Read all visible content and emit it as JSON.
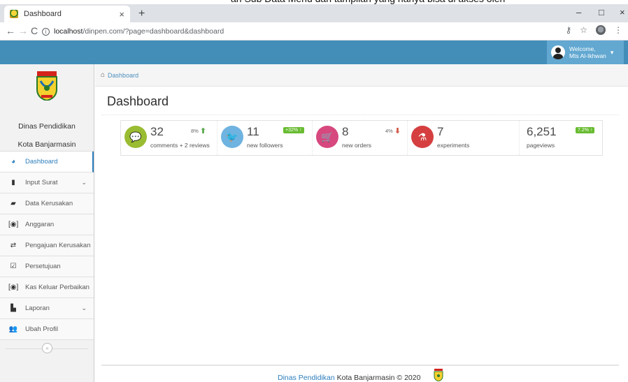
{
  "browser": {
    "tab_title": "Dashboard",
    "tab_close": "×",
    "new_tab": "+",
    "window_controls": [
      "–",
      "□",
      "×"
    ],
    "url_host": "localhost",
    "url_path": "/dinpen.com/?page=dashboard&dashboard",
    "icons": [
      "key-icon",
      "star-icon",
      "extension-icon",
      "menu-icon"
    ]
  },
  "header": {
    "welcome": "Welcome,",
    "username": "Mts Al-Ikhwan"
  },
  "sidebar": {
    "brand_line1": "Dinas Pendidikan",
    "brand_line2": "Kota Banjarmasin",
    "items": [
      {
        "label": "Dashboard",
        "icon": "tachometer-icon",
        "active": true
      },
      {
        "label": "Input Surat",
        "icon": "file-icon",
        "caret": true
      },
      {
        "label": "Data Kerusakan",
        "icon": "folder-open-icon"
      },
      {
        "label": "Anggaran",
        "icon": "money-icon"
      },
      {
        "label": "Pengajuan Kerusakan",
        "icon": "exchange-icon"
      },
      {
        "label": "Persetujuan",
        "icon": "check-square-icon"
      },
      {
        "label": "Kas Keluar Perbaikan",
        "icon": "money-icon"
      },
      {
        "label": "Laporan",
        "icon": "book-icon",
        "caret": true
      },
      {
        "label": "Ubah Profil",
        "icon": "users-icon"
      }
    ],
    "collapse_glyph": "«"
  },
  "breadcrumb": {
    "label": "Dashboard"
  },
  "page": {
    "title": "Dashboard"
  },
  "infoboxes": [
    {
      "number": "32",
      "caption": "comments + 2 reviews",
      "pct": "8%",
      "trend": "up",
      "color": "#9abc32",
      "icon": "comments-icon"
    },
    {
      "number": "11",
      "caption": "new followers",
      "badge": "+32%",
      "color": "#6fb3e0",
      "icon": "twitter-icon"
    },
    {
      "number": "8",
      "caption": "new orders",
      "pct": "4%",
      "trend": "down",
      "color": "#d6487e",
      "icon": "shopping-cart-icon"
    },
    {
      "number": "7",
      "caption": "experiments",
      "color": "#d53f40",
      "icon": "flask-icon"
    },
    {
      "number": "6,251",
      "caption": "pageviews",
      "badge": "7.2%",
      "color": "#6fb3e0",
      "icon": ""
    }
  ],
  "footer": {
    "org": "Dinas Pendidikan",
    "rest": "Kota Banjarmasin © 2020"
  }
}
